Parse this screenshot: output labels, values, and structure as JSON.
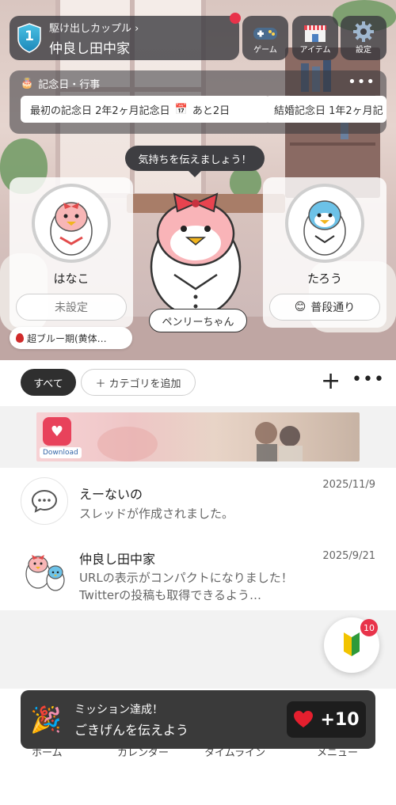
{
  "header": {
    "rank_label": "駆け出しカップル",
    "level": "1",
    "family_name": "仲良し田中家"
  },
  "top_buttons": {
    "game_label": "ゲーム",
    "item_label": "アイテム",
    "settings_label": "設定"
  },
  "anniversary": {
    "title": "記念日・行事",
    "items": [
      {
        "label": "最初の記念日 2年2ヶ月記念日",
        "remaining": "あと2日"
      },
      {
        "label": "結婚記念日 1年2ヶ月記"
      }
    ]
  },
  "speech": "気持ちを伝えましょう！",
  "pet": {
    "name": "ペンリーちゃん"
  },
  "profiles": [
    {
      "name": "はなこ",
      "status": "未設定",
      "cycle": "超ブルー期(黄体…"
    },
    {
      "name": "たろう",
      "status": "普段通り"
    }
  ],
  "tabs": {
    "all_label": "すべて",
    "add_category_label": "カテゴリを追加"
  },
  "ad": {
    "download_label": "Download"
  },
  "threads": [
    {
      "title": "えーないの",
      "date": "2025/11/9",
      "body": "スレッドが作成されました。"
    },
    {
      "title": "仲良し田中家",
      "date": "2025/9/21",
      "body": "URLの表示がコンパクトになりました！Twitterの投稿も取得できるよう…"
    }
  ],
  "beginner": {
    "badge": "10"
  },
  "bottom_nav": [
    "ホーム",
    "カレンダー",
    "タイムライン",
    "メニュー"
  ],
  "toast": {
    "title": "ミッション達成！",
    "message": "ごきげんを伝えよう",
    "reward": "+10"
  },
  "colors": {
    "accent_red": "#e8334a",
    "dark_panel": "#3a3a3a",
    "beginner_green": "#2e9a3a",
    "beginner_yellow": "#f2c400"
  }
}
